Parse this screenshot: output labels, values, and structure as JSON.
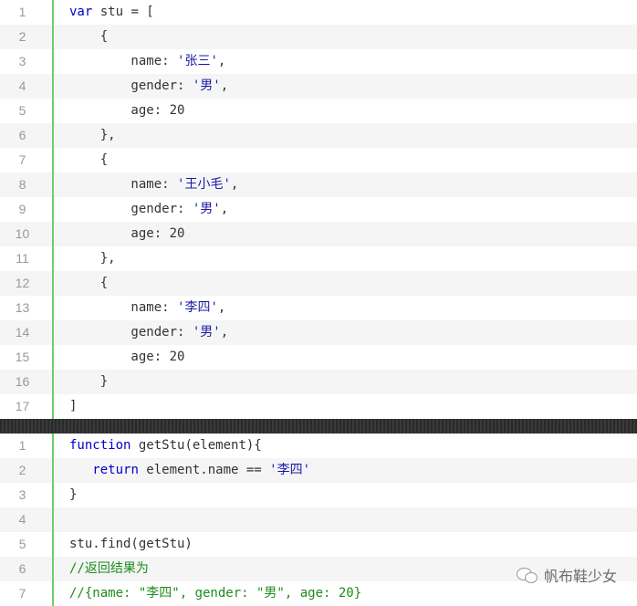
{
  "block1": {
    "lines": [
      {
        "n": "1",
        "tokens": [
          {
            "t": "var",
            "c": "kw"
          },
          {
            "t": " stu = [",
            "c": ""
          }
        ]
      },
      {
        "n": "2",
        "tokens": [
          {
            "t": "    {",
            "c": ""
          }
        ]
      },
      {
        "n": "3",
        "tokens": [
          {
            "t": "        name: ",
            "c": ""
          },
          {
            "t": "'张三'",
            "c": "str"
          },
          {
            "t": ",",
            "c": ""
          }
        ]
      },
      {
        "n": "4",
        "tokens": [
          {
            "t": "        gender: ",
            "c": ""
          },
          {
            "t": "'男'",
            "c": "str"
          },
          {
            "t": ",",
            "c": ""
          }
        ]
      },
      {
        "n": "5",
        "tokens": [
          {
            "t": "        age: 20",
            "c": ""
          }
        ]
      },
      {
        "n": "6",
        "tokens": [
          {
            "t": "    },",
            "c": ""
          }
        ]
      },
      {
        "n": "7",
        "tokens": [
          {
            "t": "    {",
            "c": ""
          }
        ]
      },
      {
        "n": "8",
        "tokens": [
          {
            "t": "        name: ",
            "c": ""
          },
          {
            "t": "'王小毛'",
            "c": "str"
          },
          {
            "t": ",",
            "c": ""
          }
        ]
      },
      {
        "n": "9",
        "tokens": [
          {
            "t": "        gender: ",
            "c": ""
          },
          {
            "t": "'男'",
            "c": "str"
          },
          {
            "t": ",",
            "c": ""
          }
        ]
      },
      {
        "n": "10",
        "tokens": [
          {
            "t": "        age: 20",
            "c": ""
          }
        ]
      },
      {
        "n": "11",
        "tokens": [
          {
            "t": "    },",
            "c": ""
          }
        ]
      },
      {
        "n": "12",
        "tokens": [
          {
            "t": "    {",
            "c": ""
          }
        ]
      },
      {
        "n": "13",
        "tokens": [
          {
            "t": "        name: ",
            "c": ""
          },
          {
            "t": "'李四'",
            "c": "str"
          },
          {
            "t": ",",
            "c": ""
          }
        ]
      },
      {
        "n": "14",
        "tokens": [
          {
            "t": "        gender: ",
            "c": ""
          },
          {
            "t": "'男'",
            "c": "str"
          },
          {
            "t": ",",
            "c": ""
          }
        ]
      },
      {
        "n": "15",
        "tokens": [
          {
            "t": "        age: 20",
            "c": ""
          }
        ]
      },
      {
        "n": "16",
        "tokens": [
          {
            "t": "    }",
            "c": ""
          }
        ]
      },
      {
        "n": "17",
        "tokens": [
          {
            "t": "]",
            "c": ""
          }
        ]
      }
    ]
  },
  "block2": {
    "lines": [
      {
        "n": "1",
        "tokens": [
          {
            "t": "function",
            "c": "kw"
          },
          {
            "t": " getStu(element){",
            "c": ""
          }
        ]
      },
      {
        "n": "2",
        "tokens": [
          {
            "t": "   ",
            "c": ""
          },
          {
            "t": "return",
            "c": "kw"
          },
          {
            "t": " element.name == ",
            "c": ""
          },
          {
            "t": "'李四'",
            "c": "str"
          }
        ]
      },
      {
        "n": "3",
        "tokens": [
          {
            "t": "}",
            "c": ""
          }
        ]
      },
      {
        "n": "4",
        "tokens": []
      },
      {
        "n": "5",
        "tokens": [
          {
            "t": "stu.find(getStu)",
            "c": ""
          }
        ]
      },
      {
        "n": "6",
        "tokens": [
          {
            "t": "//返回结果为",
            "c": "cmt"
          }
        ]
      },
      {
        "n": "7",
        "tokens": [
          {
            "t": "//{name: \"李四\", gender: \"男\", age: 20}",
            "c": "cmt"
          }
        ]
      }
    ]
  },
  "watermark": {
    "icon": "wechat-icon",
    "text": "帆布鞋少女"
  },
  "colors": {
    "keyword": "#0000c8",
    "string": "#1a1aa6",
    "comment": "#1c8c1c",
    "gutter_border": "#6ccd6c",
    "line_number": "#999999"
  }
}
